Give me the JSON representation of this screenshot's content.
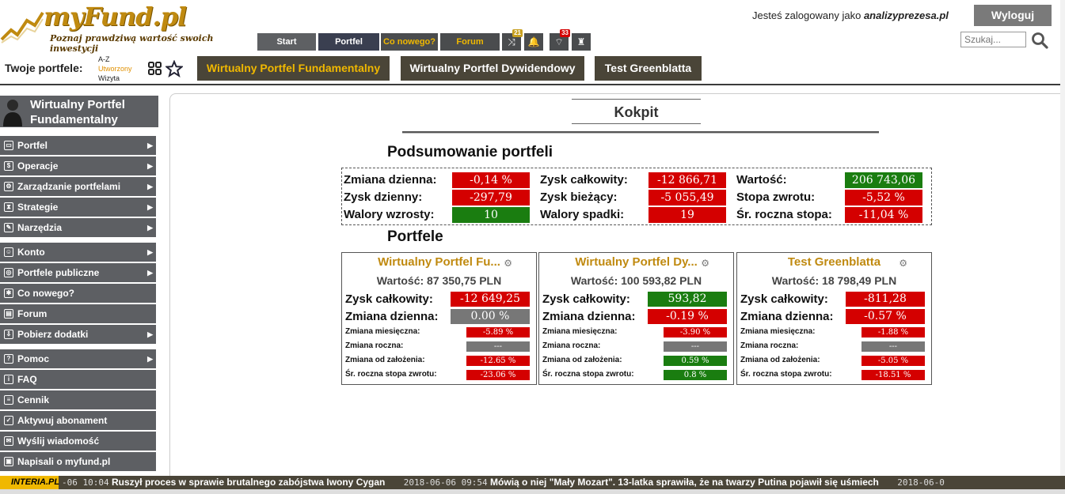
{
  "header": {
    "logo_text": "myFund.pl",
    "tagline": "Poznaj prawdziwą wartość swoich inwestycji",
    "logged_prefix": "Jesteś zalogowany jako",
    "username": "analizyprezesa.pl",
    "logout_label": "Wyloguj",
    "search_placeholder": "Szukaj...",
    "nav": {
      "start": "Start",
      "portfel": "Portfel",
      "co_nowego": "Co nowego?",
      "forum": "Forum",
      "badge_shuffle": "21",
      "badge_news": "33"
    }
  },
  "portfolio_bar": {
    "label": "Twoje portfele:",
    "sort_options": [
      "A-Z",
      "Utworzony",
      "Wizyta"
    ],
    "sort_selected": "Utworzony",
    "portfolios": [
      {
        "name": "Wirtualny Portfel Fundamentalny",
        "active": true
      },
      {
        "name": "Wirtualny Portfel Dywidendowy",
        "active": false
      },
      {
        "name": "Test Greenblatta",
        "active": false
      }
    ]
  },
  "sidebar": {
    "title": "Wirtualny Portfel Fundamentalny",
    "items": [
      {
        "label": "Portfel",
        "icon": "wallet-icon",
        "glyph": "▭",
        "arrow": true
      },
      {
        "label": "Operacje",
        "icon": "dollar-icon",
        "glyph": "$",
        "arrow": true
      },
      {
        "label": "Zarządzanie portfelami",
        "icon": "gear-icon",
        "glyph": "⚙",
        "arrow": true
      },
      {
        "label": "Strategie",
        "icon": "hourglass-icon",
        "glyph": "⧗",
        "arrow": true
      },
      {
        "label": "Narzędzia",
        "icon": "tools-icon",
        "glyph": "✎",
        "arrow": true
      },
      {
        "label": "Konto",
        "icon": "user-icon",
        "glyph": "☺",
        "arrow": true
      },
      {
        "label": "Portfele publiczne",
        "icon": "globe-icon",
        "glyph": "◎",
        "arrow": true
      },
      {
        "label": "Co nowego?",
        "icon": "star-icon",
        "glyph": "✱",
        "arrow": false
      },
      {
        "label": "Forum",
        "icon": "chat-icon",
        "glyph": "▤",
        "arrow": false
      },
      {
        "label": "Pobierz dodatki",
        "icon": "download-icon",
        "glyph": "⇩",
        "arrow": true
      },
      {
        "label": "Pomoc",
        "icon": "help-icon",
        "glyph": "?",
        "arrow": true
      },
      {
        "label": "FAQ",
        "icon": "info-icon",
        "glyph": "i",
        "arrow": false
      },
      {
        "label": "Cennik",
        "icon": "price-icon",
        "glyph": "≡",
        "arrow": false
      },
      {
        "label": "Aktywuj abonament",
        "icon": "key-icon",
        "glyph": "✓",
        "arrow": false
      },
      {
        "label": "Wyślij wiadomość",
        "icon": "mail-icon",
        "glyph": "✉",
        "arrow": false
      },
      {
        "label": "Napisali o myfund.pl",
        "icon": "news-icon",
        "glyph": "▣",
        "arrow": false
      }
    ]
  },
  "main": {
    "kokpit": "Kokpit",
    "summary_title": "Podsumowanie portfeli",
    "summary": [
      {
        "label": "Zmiana dzienna:",
        "value": "-0,14 %",
        "color": "red"
      },
      {
        "label": "Zysk dzienny:",
        "value": "-297,79",
        "color": "red"
      },
      {
        "label": "Walory wzrosty:",
        "value": "10",
        "color": "green"
      },
      {
        "label": "Zysk całkowity:",
        "value": "-12 866,71",
        "color": "red"
      },
      {
        "label": "Zysk bieżący:",
        "value": "-5 055,49",
        "color": "red"
      },
      {
        "label": "Walory spadki:",
        "value": "19",
        "color": "red"
      },
      {
        "label": "Wartość:",
        "value": "206 743,06",
        "color": "green"
      },
      {
        "label": "Stopa zwrotu:",
        "value": "-5,52 %",
        "color": "red"
      },
      {
        "label": "Śr. roczna stopa:",
        "value": "-11,04 %",
        "color": "red"
      }
    ],
    "portfele_title": "Portfele",
    "cards": [
      {
        "title": "Wirtualny Portfel Fu...",
        "value": "Wartość: 87 350,75 PLN",
        "zysk_label": "Zysk całkowity:",
        "zysk": "-12 649,25",
        "zysk_color": "red",
        "dzienna_label": "Zmiana dzienna:",
        "dzienna": "0.00 %",
        "dzienna_color": "gray",
        "miesieczna_label": "Zmiana miesięczna:",
        "miesieczna": "-5.89 %",
        "miesieczna_color": "red",
        "roczna_label": "Zmiana roczna:",
        "roczna": "---",
        "roczna_color": "gray",
        "zalozenia_label": "Zmiana od założenia:",
        "zalozenia": "-12.65 %",
        "zalozenia_color": "red",
        "stopa_label": "Śr. roczna stopa zwrotu:",
        "stopa": "-23.06 %",
        "stopa_color": "red"
      },
      {
        "title": "Wirtualny Portfel Dy...",
        "value": "Wartość: 100 593,82 PLN",
        "zysk_label": "Zysk całkowity:",
        "zysk": "593,82",
        "zysk_color": "green",
        "dzienna_label": "Zmiana dzienna:",
        "dzienna": "-0.19 %",
        "dzienna_color": "red",
        "miesieczna_label": "Zmiana miesięczna:",
        "miesieczna": "-3.90 %",
        "miesieczna_color": "red",
        "roczna_label": "Zmiana roczna:",
        "roczna": "---",
        "roczna_color": "gray",
        "zalozenia_label": "Zmiana od założenia:",
        "zalozenia": "0.59 %",
        "zalozenia_color": "green",
        "stopa_label": "Śr. roczna stopa zwrotu:",
        "stopa": "0.8 %",
        "stopa_color": "green"
      },
      {
        "title": "Test Greenblatta",
        "value": "Wartość: 18 798,49 PLN",
        "zysk_label": "Zysk całkowity:",
        "zysk": "-811,28",
        "zysk_color": "red",
        "dzienna_label": "Zmiana dzienna:",
        "dzienna": "-0.57 %",
        "dzienna_color": "red",
        "miesieczna_label": "Zmiana miesięczna:",
        "miesieczna": "-1.88 %",
        "miesieczna_color": "red",
        "roczna_label": "Zmiana roczna:",
        "roczna": "---",
        "roczna_color": "gray",
        "zalozenia_label": "Zmiana od założenia:",
        "zalozenia": "-5.05 %",
        "zalozenia_color": "red",
        "stopa_label": "Śr. roczna stopa zwrotu:",
        "stopa": "-18.51 %",
        "stopa_color": "red"
      }
    ]
  },
  "ticker": {
    "logo": "INTERIA.PL",
    "items": [
      {
        "time": "-06 10:04",
        "headline": "Ruszył proces w sprawie brutalnego zabójstwa Iwony Cygan"
      },
      {
        "time": "2018-06-06 09:54",
        "headline": "Mówią o niej \"Mały Mozart\". 13-latka sprawiła, że na twarzy Putina pojawił się uśmiech"
      },
      {
        "time": "2018-06-0",
        "headline": ""
      }
    ]
  },
  "colors": {
    "red": "#d40000",
    "green": "#1a7d10",
    "gray": "#777777",
    "gold": "#c08a10",
    "sidebar_bg": "#5d5f63"
  }
}
